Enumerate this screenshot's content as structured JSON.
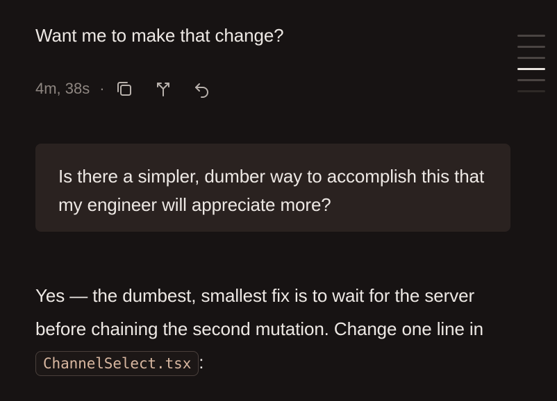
{
  "conversation": {
    "previous_assistant_tail": "Want me to make that change?",
    "meta": {
      "duration": "4m, 38s",
      "separator": "·",
      "actions": [
        {
          "name": "copy-icon"
        },
        {
          "name": "branch-icon"
        },
        {
          "name": "undo-icon"
        }
      ]
    },
    "user_message": "Is there a simpler, dumber way to accomplish this that my engineer will appreciate more?",
    "answer": {
      "part1": "Yes — the dumbest, smallest fix is to wait for the server before chaining the second mutation. Change one line in ",
      "code": "ChannelSelect.tsx",
      "part2": ":"
    }
  },
  "minimap": {
    "markers": 6,
    "active_index": 3
  },
  "colors": {
    "background": "#171313",
    "bubble": "#2a2220",
    "text": "#ede8e4",
    "muted": "#8e8681",
    "code_text": "#d8b7a0"
  }
}
